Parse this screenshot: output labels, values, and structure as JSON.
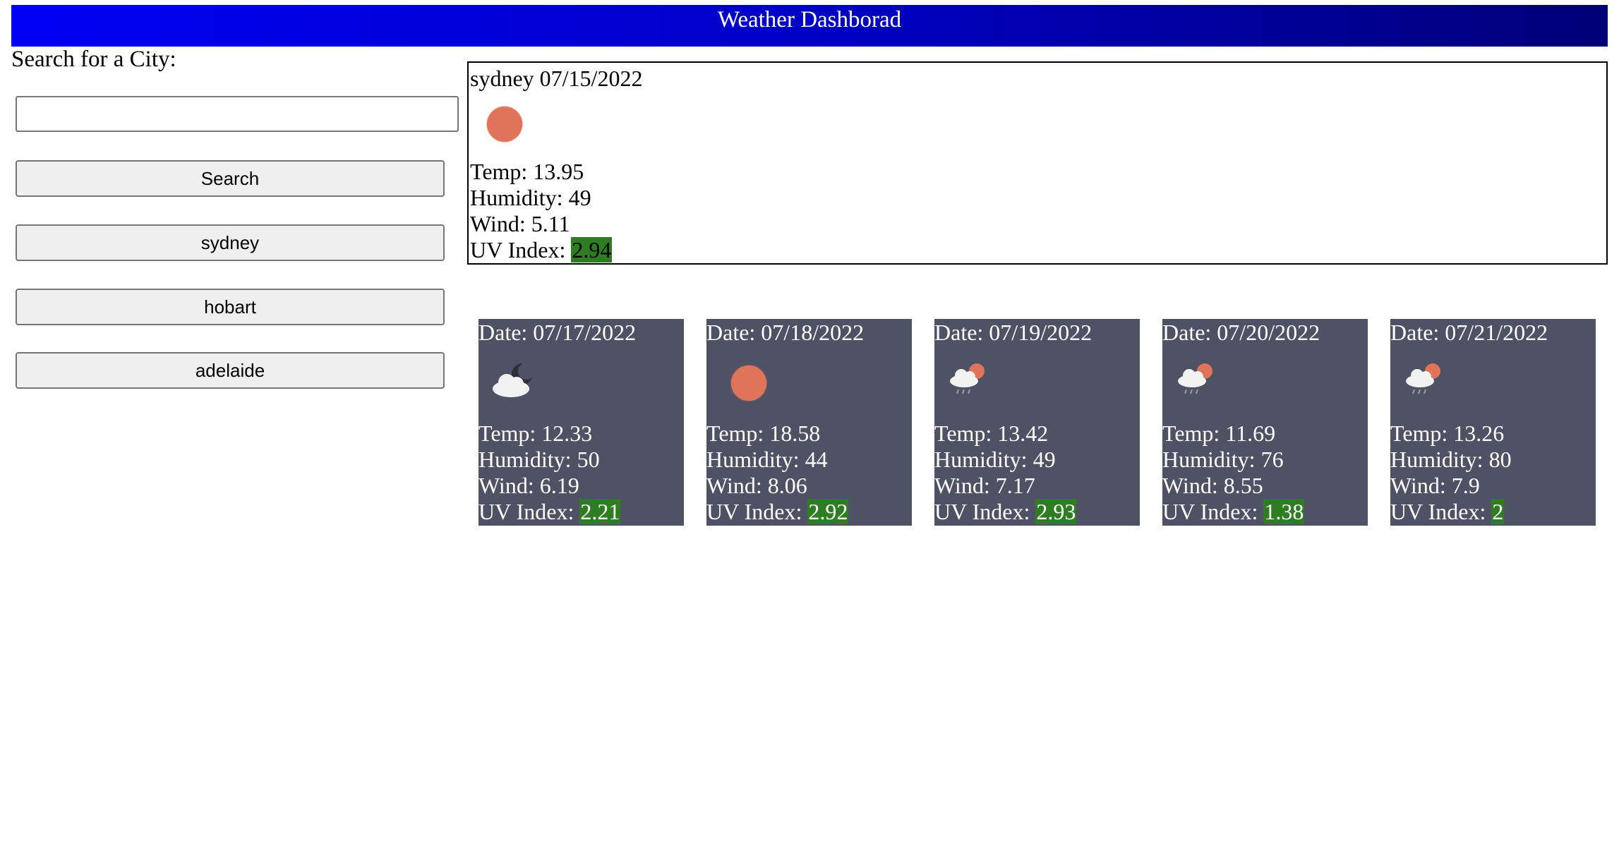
{
  "header": {
    "title": "Weather Dashborad"
  },
  "search": {
    "label": "Search for a City:",
    "value": "",
    "placeholder": "",
    "button_label": "Search"
  },
  "history": [
    {
      "label": "sydney"
    },
    {
      "label": "hobart"
    },
    {
      "label": "adelaide"
    }
  ],
  "current": {
    "title": "sydney 07/15/2022",
    "icon": "sun-icon",
    "temp": "Temp: 13.95",
    "humidity": "Humidity: 49",
    "wind": "Wind: 5.11",
    "uv_label": "UV Index: ",
    "uv_value": "2.94"
  },
  "forecast": [
    {
      "date": "Date: 07/17/2022",
      "icon": "cloudy-night-icon",
      "temp": "Temp: 12.33",
      "humidity": "Humidity: 50",
      "wind": "Wind: 6.19",
      "uv_label": "UV Index: ",
      "uv_value": "2.21"
    },
    {
      "date": "Date: 07/18/2022",
      "icon": "sun-icon",
      "temp": "Temp: 18.58",
      "humidity": "Humidity: 44",
      "wind": "Wind: 8.06",
      "uv_label": "UV Index: ",
      "uv_value": "2.92"
    },
    {
      "date": "Date: 07/19/2022",
      "icon": "rain-sun-icon",
      "temp": "Temp: 13.42",
      "humidity": "Humidity: 49",
      "wind": "Wind: 7.17",
      "uv_label": "UV Index: ",
      "uv_value": "2.93"
    },
    {
      "date": "Date: 07/20/2022",
      "icon": "rain-sun-icon",
      "temp": "Temp: 11.69",
      "humidity": "Humidity: 76",
      "wind": "Wind: 8.55",
      "uv_label": "UV Index: ",
      "uv_value": "1.38"
    },
    {
      "date": "Date: 07/21/2022",
      "icon": "rain-sun-icon",
      "temp": "Temp: 13.26",
      "humidity": "Humidity: 80",
      "wind": "Wind: 7.9",
      "uv_label": "UV Index: ",
      "uv_value": "2"
    }
  ],
  "colors": {
    "header_start": "#0000f4",
    "header_end": "#000077",
    "card_bg": "#4f5164",
    "uv_low": "#2e7d22",
    "sun": "#e0745a"
  }
}
